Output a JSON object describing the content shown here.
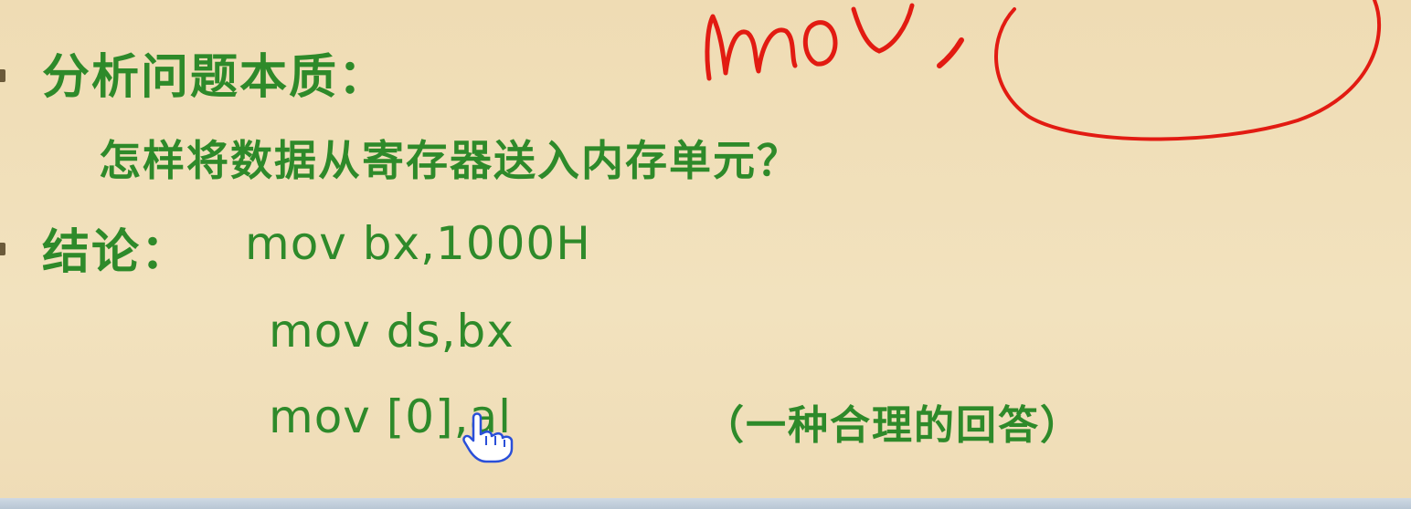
{
  "slide": {
    "heading": "分析问题本质：",
    "question": "怎样将数据从寄存器送入内存单元？",
    "conclusion_label": "结论：",
    "code": [
      "mov bx,1000H",
      "mov ds,bx",
      "mov [0],al"
    ],
    "note": "（一种合理的回答）"
  },
  "annotation": {
    "handwriting": "mov,",
    "ink_color": "#e21b12"
  },
  "colors": {
    "text": "#2e8a2a",
    "background": "#efdcb4"
  },
  "icons": {
    "cursor": "hand-pointer-icon"
  }
}
